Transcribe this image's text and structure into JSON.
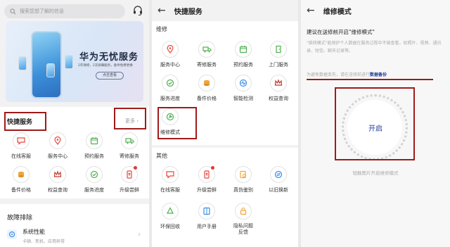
{
  "panel1": {
    "search_placeholder": "搜索您想了解的信息",
    "banner": {
      "title": "华为无忧服务",
      "subtitle": "2年保修，2次屏幕服务，备件免费更换",
      "button": "点击查看"
    },
    "quick_title": "快捷服务",
    "more": "更多",
    "items": [
      {
        "label": "在线客服",
        "icon": "chat-icon"
      },
      {
        "label": "服务中心",
        "icon": "location-pin-icon"
      },
      {
        "label": "预约服务",
        "icon": "calendar-icon"
      },
      {
        "label": "寄修服务",
        "icon": "truck-icon"
      },
      {
        "label": "备件价格",
        "icon": "coins-icon"
      },
      {
        "label": "权益查询",
        "icon": "crown-icon"
      },
      {
        "label": "服务进度",
        "icon": "progress-icon"
      },
      {
        "label": "升级尝鲜",
        "icon": "phone-upgrade-icon"
      }
    ],
    "troubleshoot_title": "故障排除",
    "system_perf": {
      "title": "系统性能",
      "desc": "卡顿、死机、应用异常"
    }
  },
  "panel2": {
    "title": "快捷服务",
    "repair_label": "维修",
    "repair_items": [
      {
        "label": "服务中心",
        "icon": "location-pin-icon"
      },
      {
        "label": "寄修服务",
        "icon": "truck-icon"
      },
      {
        "label": "预约服务",
        "icon": "calendar-icon"
      },
      {
        "label": "上门服务",
        "icon": "door-icon"
      },
      {
        "label": "服务进度",
        "icon": "progress-icon"
      },
      {
        "label": "备件价格",
        "icon": "coins-icon"
      },
      {
        "label": "智能检测",
        "icon": "diagnose-icon"
      },
      {
        "label": "权益查询",
        "icon": "crown-icon"
      },
      {
        "label": "维修模式",
        "icon": "wrench-icon"
      }
    ],
    "other_label": "其他",
    "other_items": [
      {
        "label": "在线客服",
        "icon": "chat-icon"
      },
      {
        "label": "升级尝鲜",
        "icon": "phone-upgrade-icon"
      },
      {
        "label": "真伪鉴别",
        "icon": "verify-icon"
      },
      {
        "label": "以旧换新",
        "icon": "exchange-icon"
      },
      {
        "label": "环保回收",
        "icon": "recycle-icon"
      },
      {
        "label": "用户手册",
        "icon": "book-icon"
      },
      {
        "label": "隐私问题反馈",
        "icon": "privacy-icon"
      }
    ]
  },
  "panel3": {
    "title": "维修模式",
    "advice": "建议在送修前开启\"维修模式\"",
    "desc": "\"维修模式\"能保护个人数据在服务过程中不被查看，如照片、视频、通讯录、短信、聊天记录等。",
    "warn_prefix": "为避免数据丢失，请在送修前进行",
    "warn_link": "数据备份",
    "start": "开启",
    "hint": "轻触图片开启维修模式"
  },
  "colors": {
    "accent": "#1f3c9e",
    "highlight": "#a01a1a",
    "badge": "#e03a3a"
  }
}
